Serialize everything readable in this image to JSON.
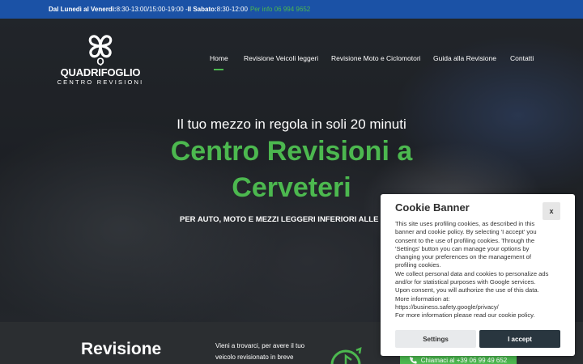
{
  "topbar": {
    "hours_prefix": "Dal Lunedì al Venerdì:",
    "hours_weekday": " 8:30-13:00/15:00-19:00 - ",
    "saturday_prefix": "Il Sabato:",
    "hours_saturday": " 8:30-12:00",
    "info_phone": "Per info 06 994 9652"
  },
  "logo": {
    "name": "QUADRIFOGLIO",
    "tagline": "CENTRO REVISIONI"
  },
  "nav": {
    "items": [
      {
        "label": "Home"
      },
      {
        "label": "Revisione Veicoli leggeri"
      },
      {
        "label": "Revisione Moto e Ciclomotori"
      },
      {
        "label": "Guida alla Revisione"
      },
      {
        "label": "Contatti"
      }
    ],
    "active_color": "#4cb84f"
  },
  "hero": {
    "subtitle": "Il tuo mezzo in regola in soli 20 minuti",
    "title_line1": "Centro Revisioni a",
    "title_line2": "Cerveteri",
    "description": "PER AUTO, MOTO E MEZZI LEGGERI INFERIORI ALLE"
  },
  "section": {
    "title": "Revisione",
    "text_line1": "Vieni a trovarci, per avere il tuo",
    "text_line2": "veicolo revisionato in breve",
    "call_button": "Chiamaci al +39 06 99 49 652"
  },
  "cookie_banner": {
    "title": "Cookie Banner",
    "close_label": "x",
    "body": [
      "This site uses profiling cookies, as described in this",
      "banner and cookie policy. By selecting 'I accept' you",
      "consent to the use of profiling cookies. Through the",
      "'Settings' button you can manage your options by",
      "changing your preferences on the management of",
      "profiling cookies.",
      "We collect personal data and cookies to personalize ads",
      "and/or for statistical purposes with Google services.",
      "Upon consent, you will authorize the use of this data.",
      "More information at:",
      "https://business.safety.google/privacy/",
      "For more information please read our cookie policy."
    ],
    "settings_label": "Settings",
    "accept_label": "I accept"
  },
  "colors": {
    "topbar_bg": "#1b52a6",
    "brand_green": "#4cb84f",
    "accept_bg": "#29363f"
  },
  "icons": [
    "cloverleaf-logo-icon",
    "clock-icon",
    "phone-icon"
  ]
}
